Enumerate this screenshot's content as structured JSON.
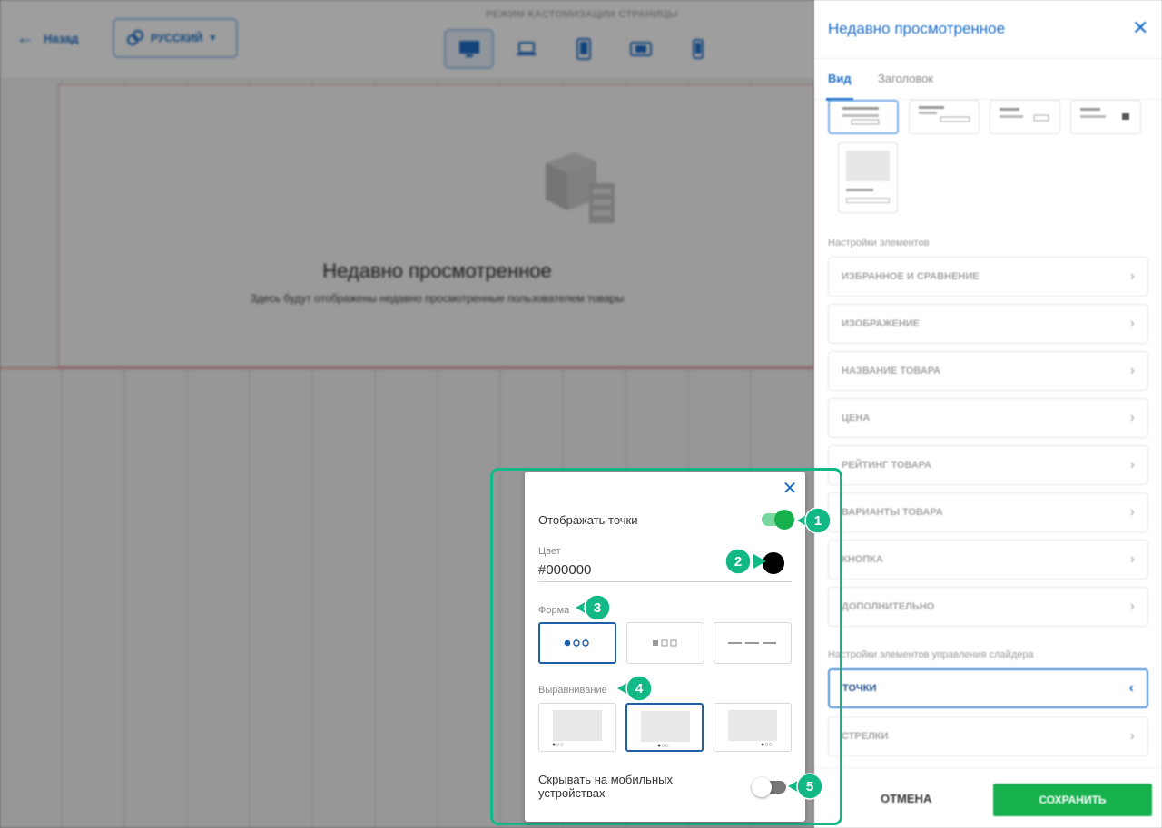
{
  "topbar": {
    "back_label": "Назад",
    "language_label": "РУССКИЙ",
    "mode_label": "РЕЖИМ КАСТОМИЗАЦИИ СТРАНИЦЫ",
    "devices": [
      "desktop-icon",
      "laptop-icon",
      "tablet-icon",
      "tablet-landscape-icon",
      "mobile-icon"
    ],
    "active_device": "desktop-icon"
  },
  "canvas": {
    "block_title": "Недавно просмотренное",
    "block_description": "Здесь будут отображены недавно просмотренные пользователем товары"
  },
  "panel": {
    "title": "Недавно просмотренное",
    "tabs": [
      "Вид",
      "Заголовок"
    ],
    "active_tab": "Вид",
    "elements_section_label": "Настройки элементов",
    "elements": [
      "ИЗБРАННОЕ И СРАВНЕНИЕ",
      "ИЗОБРАЖЕНИЕ",
      "НАЗВАНИЕ ТОВАРА",
      "ЦЕНА",
      "РЕЙТИНГ ТОВАРА",
      "ВАРИАНТЫ ТОВАРА",
      "КНОПКА",
      "ДОПОЛНИТЕЛЬНО"
    ],
    "slider_section_label": "Настройки элементов управления слайдера",
    "slider_controls": [
      "ТОЧКИ",
      "СТРЕЛКИ"
    ],
    "active_slider_control": "ТОЧКИ",
    "cancel_label": "ОТМЕНА",
    "save_label": "СОХРАНИТЬ"
  },
  "popup": {
    "show_dots_label": "Отображать точки",
    "show_dots_enabled": true,
    "color_label": "Цвет",
    "color_value": "#000000",
    "shape_label": "Форма",
    "shape_options": [
      "●○○",
      "■□□",
      "———"
    ],
    "selected_shape": 0,
    "alignment_label": "Выравнивание",
    "alignment_dots": "●○○",
    "selected_alignment": 1,
    "hide_mobile_label": "Скрывать на мобильных устройствах",
    "hide_mobile_enabled": false
  },
  "callouts": [
    "1",
    "2",
    "3",
    "4",
    "5"
  ],
  "colors": {
    "accent_blue": "#1e6fc9",
    "callout_green": "#12b886",
    "save_green": "#16b04c",
    "toggle_on": "#16b04c"
  }
}
